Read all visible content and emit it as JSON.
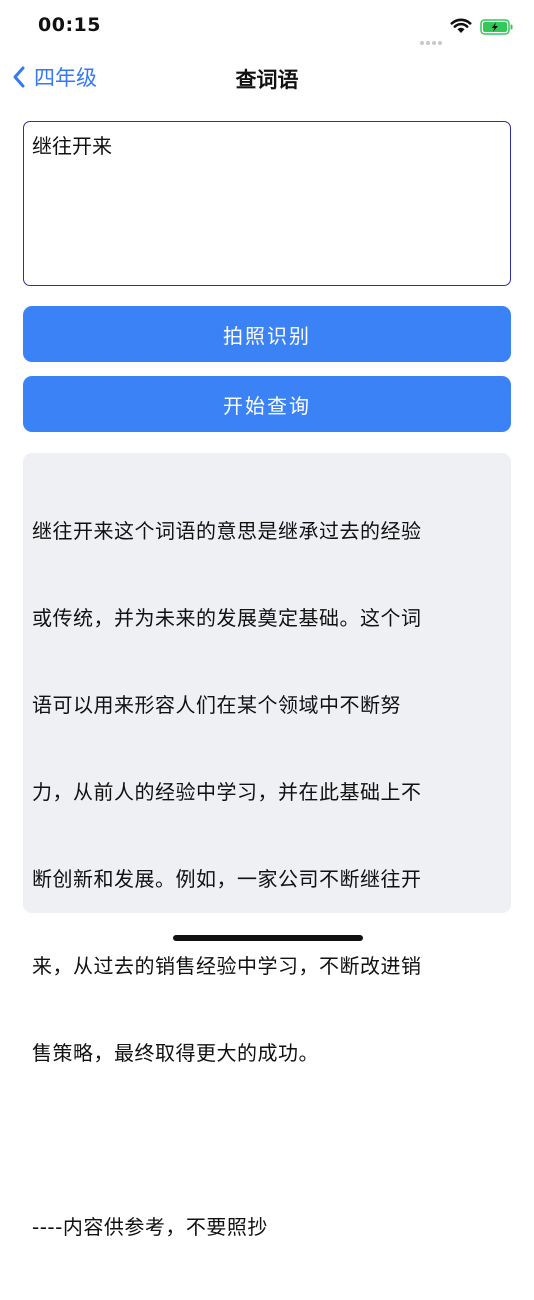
{
  "status_bar": {
    "time": "00:15",
    "signal_icon": "cellular-dots-icon",
    "wifi_icon": "wifi-icon",
    "battery_icon": "battery-charging-icon",
    "battery_color": "#34c759"
  },
  "nav": {
    "back_label": "四年级",
    "back_icon": "chevron-left-icon",
    "title": "查词语"
  },
  "input": {
    "value": "继往开来",
    "border_color": "#2d2fa8"
  },
  "buttons": {
    "photo_label": "拍照识别",
    "query_label": "开始查询",
    "color": "#3b82f6"
  },
  "result": {
    "lines": [
      "继往开来这个词语的意思是继承过去的经验",
      "或传统，并为未来的发展奠定基础。这个词",
      "语可以用来形容人们在某个领域中不断努",
      "力，从前人的经验中学习，并在此基础上不",
      "断创新和发展。例如，一家公司不断继往开",
      "来，从过去的销售经验中学习，不断改进销",
      "售策略，最终取得更大的成功。",
      "",
      "----内容供参考，不要照抄"
    ]
  }
}
